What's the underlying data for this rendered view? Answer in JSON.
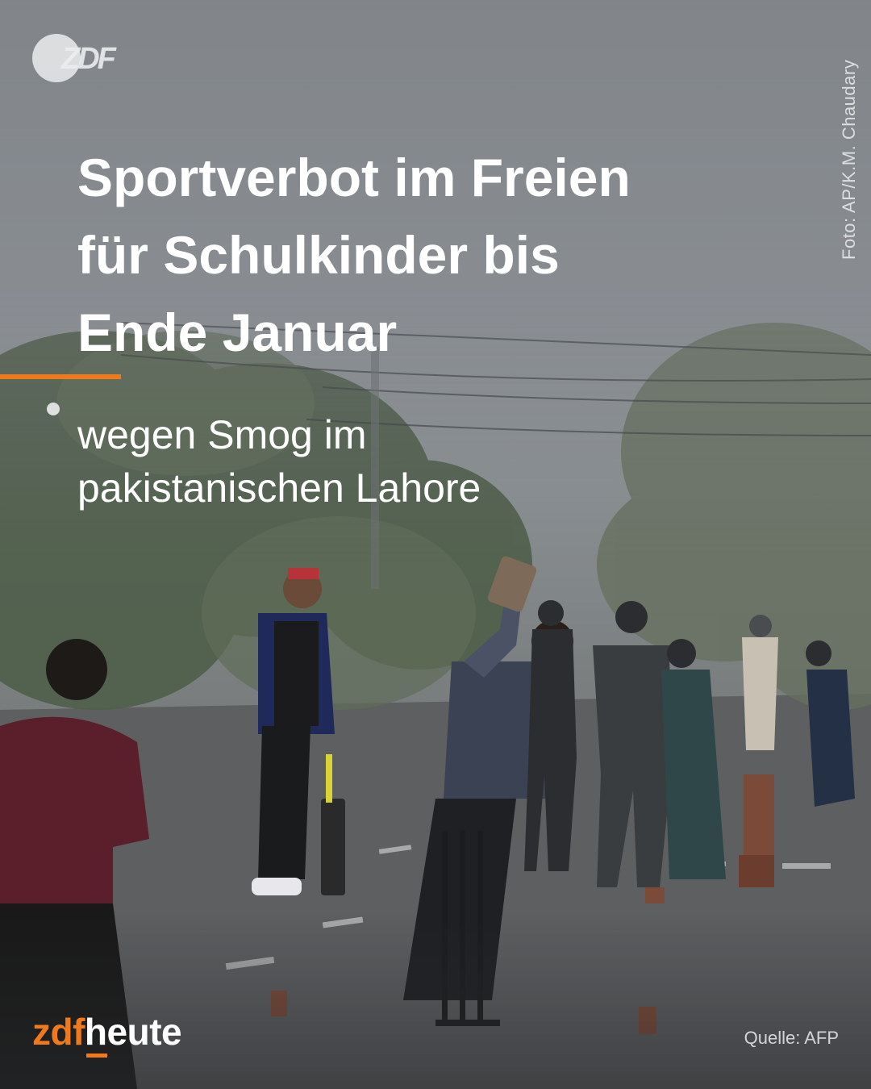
{
  "logo": {
    "label": "ZDF"
  },
  "photo_credit": "Foto: AP/K.M. Chaudary",
  "headline_lines": [
    "Sportverbot im Freien",
    "für Schulkinder bis",
    "Ende Januar"
  ],
  "subline_lines": [
    "wegen Smog im",
    "pakistanischen Lahore"
  ],
  "brand": {
    "zdf": "zdf",
    "heute": "heute"
  },
  "source": "Quelle: AFP",
  "colors": {
    "accent": "#f07a1a",
    "text": "#ffffff"
  }
}
